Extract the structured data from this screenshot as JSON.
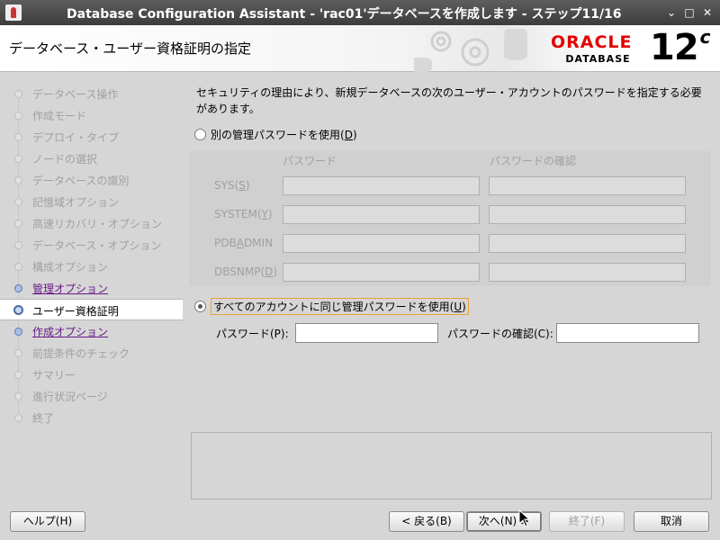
{
  "window": {
    "title": "Database Configuration Assistant - 'rac01'データベースを作成します - ステップ11/16",
    "controls": {
      "minimize": "⌄",
      "maximize": "□",
      "close": "✕"
    }
  },
  "header": {
    "page_title": "データベース・ユーザー資格証明の指定",
    "logo_brand": "ORACLE",
    "logo_product": "DATABASE",
    "version": "12",
    "version_suffix": "c"
  },
  "nav": {
    "items": [
      {
        "label": "データベース操作",
        "state": "done"
      },
      {
        "label": "作成モード",
        "state": "done"
      },
      {
        "label": "デプロイ・タイプ",
        "state": "done"
      },
      {
        "label": "ノードの選択",
        "state": "done"
      },
      {
        "label": "データベースの識別",
        "state": "done"
      },
      {
        "label": "記憶域オプション",
        "state": "done"
      },
      {
        "label": "高速リカバリ・オプション",
        "state": "done"
      },
      {
        "label": "データベース・オプション",
        "state": "done"
      },
      {
        "label": "構成オプション",
        "state": "done"
      },
      {
        "label": "管理オプション",
        "state": "link"
      },
      {
        "label": "ユーザー資格証明",
        "state": "current"
      },
      {
        "label": "作成オプション",
        "state": "link"
      },
      {
        "label": "前提条件のチェック",
        "state": "pending"
      },
      {
        "label": "サマリー",
        "state": "pending"
      },
      {
        "label": "進行状況ページ",
        "state": "pending"
      },
      {
        "label": "終了",
        "state": "pending"
      }
    ]
  },
  "main": {
    "intro": "セキュリティの理由により、新規データベースの次のユーザー・アカウントのパスワードを指定する必要があります。",
    "option_separate": {
      "label": "別の管理パスワードを使用(",
      "mnemonic": "D",
      "suffix": ")",
      "selected": false
    },
    "grid": {
      "col_password": "パスワード",
      "col_confirm": "パスワードの確認",
      "rows": [
        {
          "label": "SYS(",
          "mnemonic": "S",
          "suffix": ")"
        },
        {
          "label": "SYSTEM(",
          "mnemonic": "Y",
          "suffix": ")"
        },
        {
          "label": "PDB",
          "mnemonic": "A",
          "suffix": "DMIN"
        },
        {
          "label": "DBSNMP(",
          "mnemonic": "D",
          "suffix": ")"
        }
      ]
    },
    "option_same": {
      "label": "すべてのアカウントに同じ管理パスワードを使用(",
      "mnemonic": "U",
      "suffix": ")",
      "selected": true
    },
    "password_label": "パスワード(P):",
    "password_value": "",
    "confirm_label": "パスワードの確認(C):",
    "confirm_value": ""
  },
  "footer": {
    "help": "ヘルプ(H)",
    "back": "< 戻る(B)",
    "next": "次へ(N) >",
    "finish": "終了(F)",
    "cancel": "取消"
  }
}
